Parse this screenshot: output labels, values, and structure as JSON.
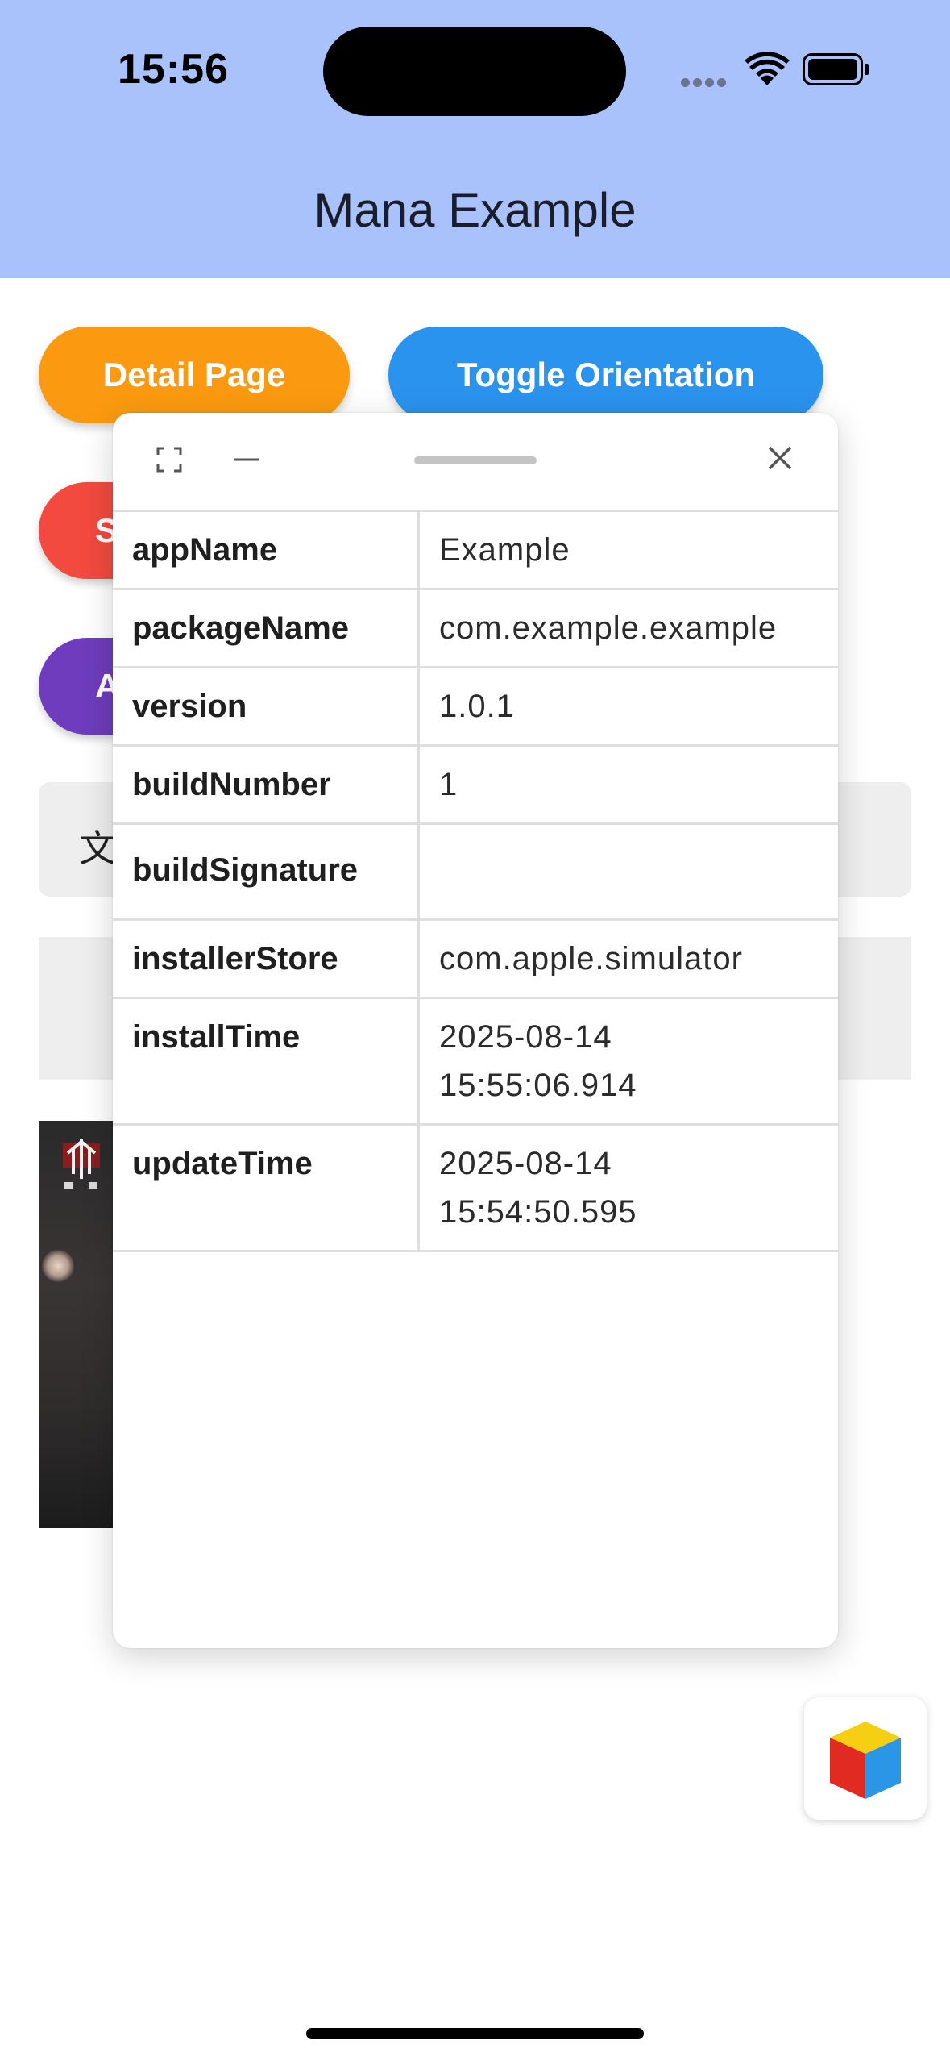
{
  "status_bar": {
    "time": "15:56"
  },
  "app_bar": {
    "title": "Mana Example",
    "background": "#a9c2fc"
  },
  "background_buttons": {
    "detail_page": "Detail Page",
    "toggle_orientation": "Toggle Orientation",
    "red_button_fragment": "S",
    "purple_button_fragment": "A"
  },
  "text_field_fragment": "文",
  "panel": {
    "rows": [
      {
        "key": "appName",
        "value": "Example"
      },
      {
        "key": "packageName",
        "value": "com.example.example"
      },
      {
        "key": "version",
        "value": "1.0.1"
      },
      {
        "key": "buildNumber",
        "value": "1"
      },
      {
        "key": "buildSignature",
        "value": ""
      },
      {
        "key": "installerStore",
        "value": "com.apple.simulator"
      },
      {
        "key": "installTime",
        "value": "2025-08-14\n15:55:06.914"
      },
      {
        "key": "updateTime",
        "value": "2025-08-14\n15:54:50.595"
      }
    ]
  },
  "colors": {
    "detail_page": "#fb9a10",
    "toggle_orientation": "#2a93ee",
    "red_button": "#f24a3f",
    "purple_button": "#6e3cbd"
  },
  "icons": {
    "expand": "expand-icon",
    "minimize": "minimize-icon",
    "close": "close-icon",
    "cube": "cube-icon"
  }
}
